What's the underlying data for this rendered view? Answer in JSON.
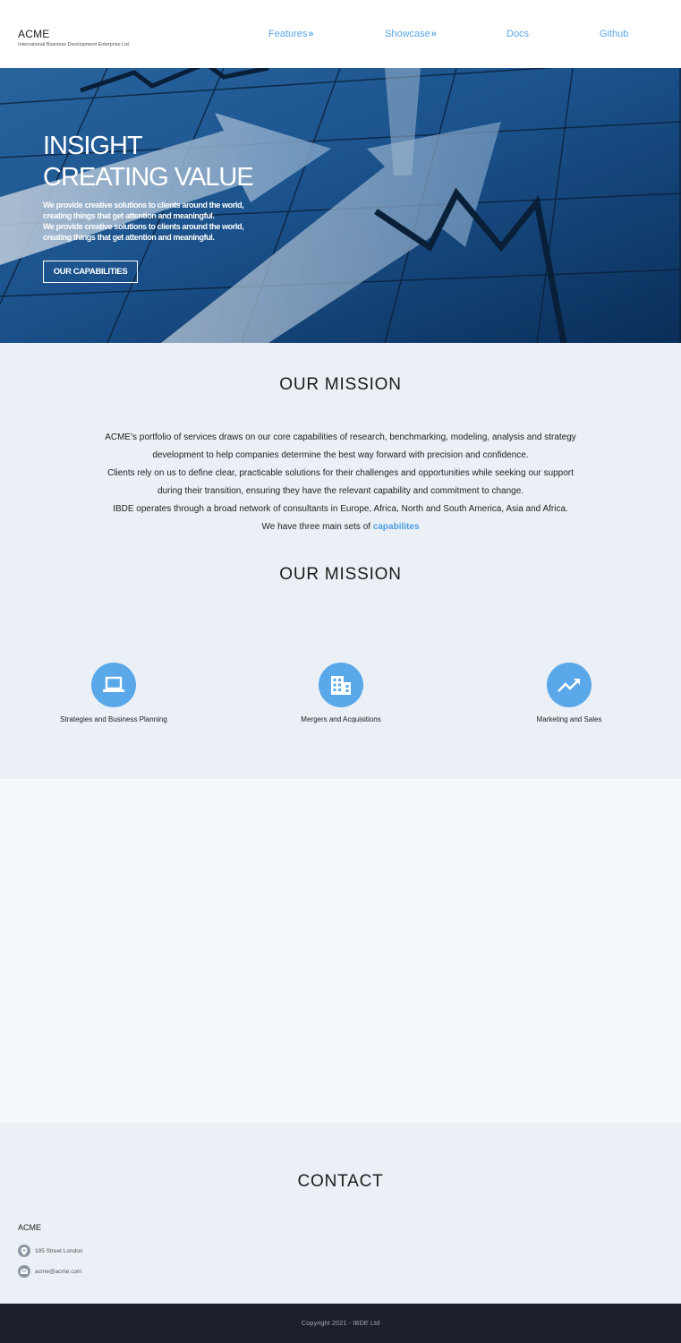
{
  "header": {
    "brand_name": "ACME",
    "brand_subtitle": "International Business Development Enterprise Ltd",
    "nav": [
      {
        "label": "Features",
        "has_chevron": true
      },
      {
        "label": "Showcase",
        "has_chevron": true
      },
      {
        "label": "Docs",
        "has_chevron": false
      },
      {
        "label": "Github",
        "has_chevron": false
      }
    ],
    "nav_chevron": "»"
  },
  "hero": {
    "title_line1": "INSIGHT",
    "title_line2": "CREATING VALUE",
    "desc_lines": [
      "We provide creative solutions to clients around the world,",
      "creating things that get attention and meaningful.",
      "We provide creative solutions to clients around the world,",
      "creating things that get attention and meaningful."
    ],
    "button_label": "OUR CAPABILITIES"
  },
  "mission": {
    "title": "OUR MISSION",
    "paragraphs": [
      "ACME's portfolio of services draws on our core capabilities of research, benchmarking, modeling, analysis and strategy development to help companies determine the best way forward with precision and confidence.",
      "Clients rely on us to define clear, practicable solutions for their challenges and opportunities while seeking our support during their transition, ensuring they have the relevant capability and commitment to change.",
      "IBDE operates through a broad network of consultants in Europe, Africa, North and South America, Asia and Africa."
    ],
    "capabilities_prefix": "We have three main sets of ",
    "capabilities_link": "capabilites",
    "title_second": "OUR MISSION",
    "capabilities": [
      {
        "label": "Strategies and Business Planning",
        "icon": "laptop-icon"
      },
      {
        "label": "Mergers and Acquisitions",
        "icon": "building-icon"
      },
      {
        "label": "Marketing and Sales",
        "icon": "trending-up-icon"
      }
    ]
  },
  "contact": {
    "title": "CONTACT",
    "org": "ACME",
    "address": "185 Street London",
    "email": "acme@acme.com"
  },
  "footer": {
    "copyright": "Copyright 2021 - IBDE Ltd"
  },
  "colors": {
    "accent": "#5aa8e9",
    "section_bg": "#ebf0f6",
    "footer_bg": "#1d202a",
    "hero_blue": "#17467e"
  }
}
